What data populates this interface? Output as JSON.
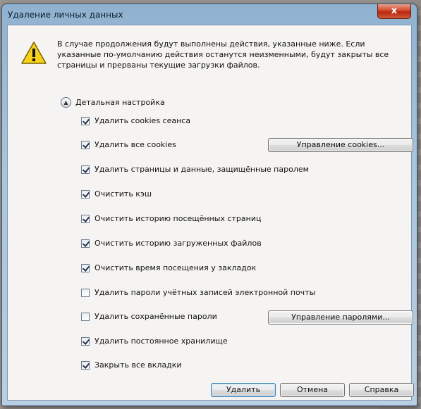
{
  "window": {
    "title": "Удаление личных данных",
    "close_label": "x"
  },
  "message": "В случае продолжения будут выполнены действия, указанные ниже. Если указанные по-умолчанию действия останутся неизменными, будут закрыты все страницы и прерваны текущие загрузки файлов.",
  "detail_label": "Детальная настройка",
  "options": [
    {
      "label": "Удалить cookies сеанса",
      "checked": true
    },
    {
      "label": "Удалить все cookies",
      "checked": true
    },
    {
      "label": "Удалить страницы и данные, защищённые паролем",
      "checked": true
    },
    {
      "label": "Очистить кэш",
      "checked": true
    },
    {
      "label": "Очистить историю посещённых страниц",
      "checked": true
    },
    {
      "label": "Очистить историю загруженных файлов",
      "checked": true
    },
    {
      "label": "Очистить время посещения у закладок",
      "checked": true
    },
    {
      "label": "Удалить пароли учётных записей электронной почты",
      "checked": false
    },
    {
      "label": "Удалить сохранённые пароли",
      "checked": false
    },
    {
      "label": "Удалить постоянное хранилище",
      "checked": true
    },
    {
      "label": "Закрыть все вкладки",
      "checked": true
    }
  ],
  "buttons": {
    "manage_cookies": "Управление cookies...",
    "manage_passwords": "Управление паролями...",
    "delete": "Удалить",
    "cancel": "Отмена",
    "help": "Справка"
  },
  "colors": {
    "titlebar": "#a9c4dc",
    "close": "#d2472c",
    "client": "#f5f4f2"
  },
  "icons": {
    "warning": "warning-icon",
    "expand": "chevron-up-icon"
  }
}
